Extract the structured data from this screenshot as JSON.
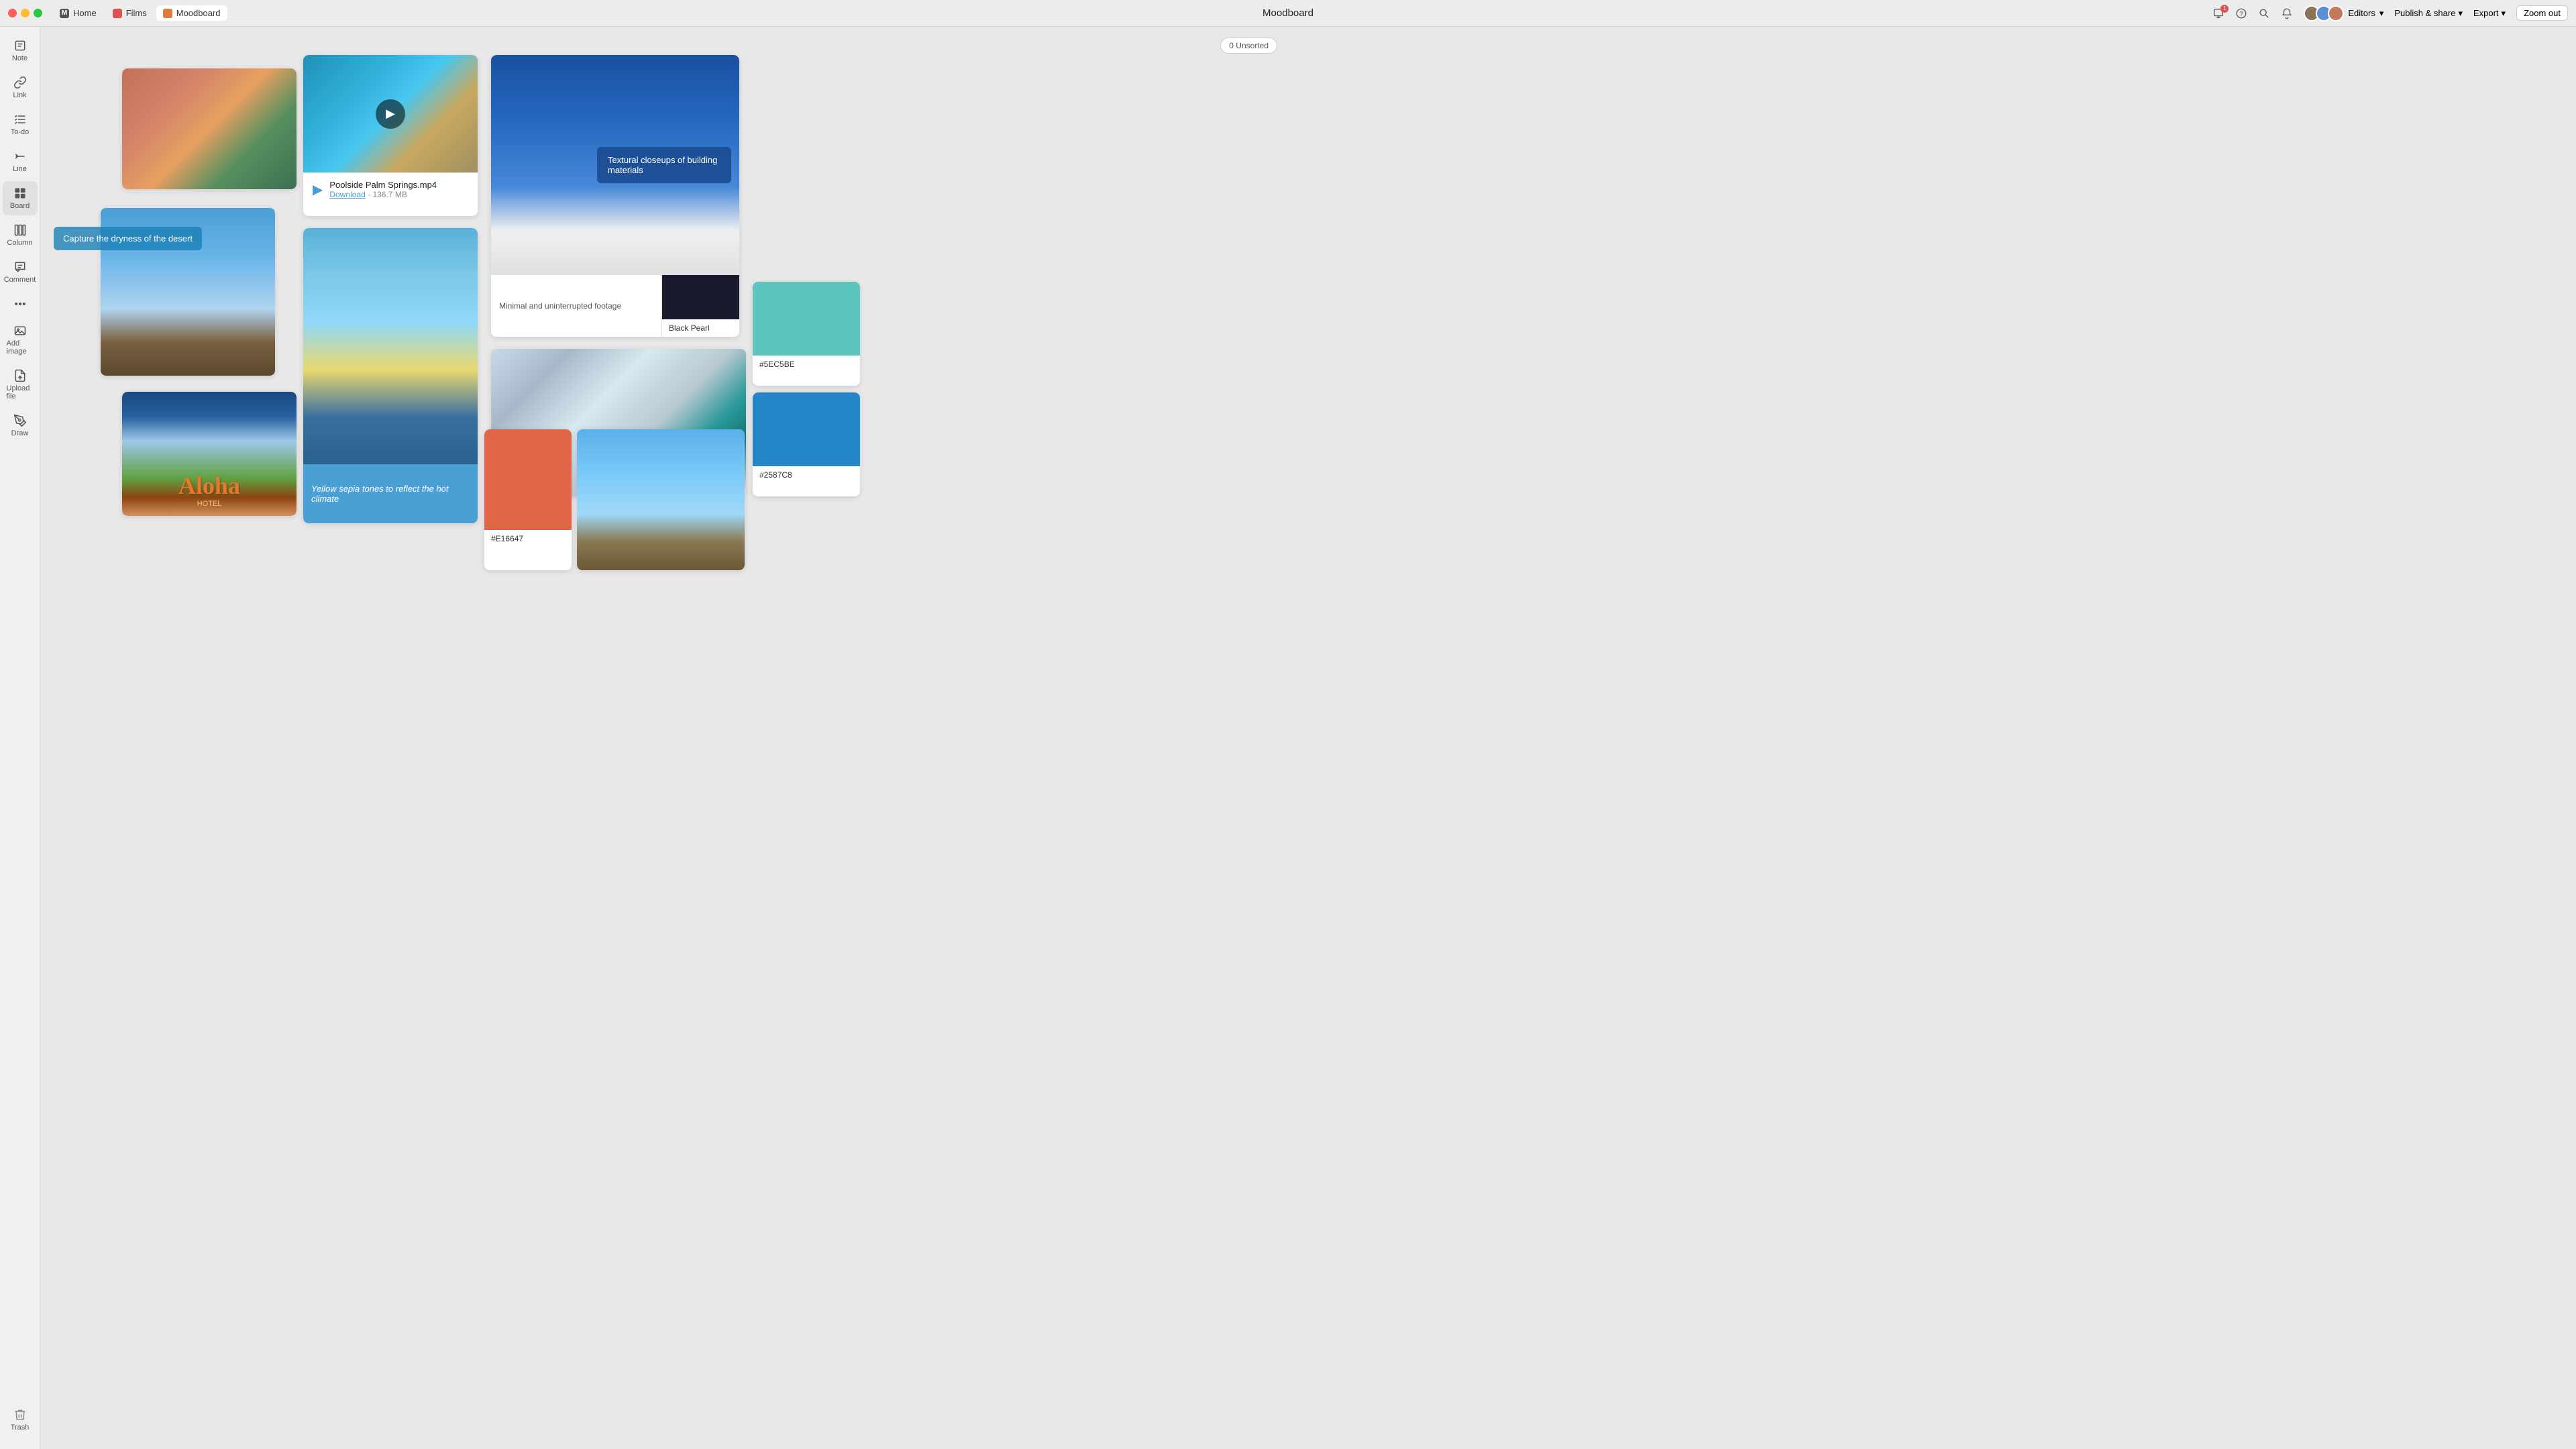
{
  "titlebar": {
    "title": "Moodboard",
    "tabs": [
      {
        "id": "home",
        "label": "Home",
        "icon": "m"
      },
      {
        "id": "films",
        "label": "Films",
        "icon": "red"
      },
      {
        "id": "moodboard",
        "label": "Moodboard",
        "icon": "orange",
        "active": true
      }
    ],
    "editors_label": "Editors",
    "publish_label": "Publish & share",
    "export_label": "Export",
    "zoom_label": "Zoom out",
    "notification_count": "1"
  },
  "sidebar": {
    "items": [
      {
        "id": "note",
        "label": "Note"
      },
      {
        "id": "link",
        "label": "Link"
      },
      {
        "id": "todo",
        "label": "To-do"
      },
      {
        "id": "line",
        "label": "Line"
      },
      {
        "id": "board",
        "label": "Board",
        "active": true
      },
      {
        "id": "column",
        "label": "Column"
      },
      {
        "id": "comment",
        "label": "Comment"
      },
      {
        "id": "more",
        "label": ""
      },
      {
        "id": "add-image",
        "label": "Add image"
      },
      {
        "id": "upload-file",
        "label": "Upload file"
      },
      {
        "id": "draw",
        "label": "Draw"
      },
      {
        "id": "trash",
        "label": "Trash"
      }
    ]
  },
  "canvas": {
    "unsorted_badge": "0 Unsorted",
    "items": {
      "desert_text": "Capture the dryness of the desert",
      "architecture_caption": "Textural closeups of building materials",
      "minimal_caption": "Minimal and uninterrupted footage",
      "black_pearl_label": "Black Pearl",
      "video_filename": "Poolside Palm Springs.mp4",
      "video_download": "Download",
      "video_size": "136.7 MB",
      "yellow_caption": "Yellow sepia tones to reflect the hot climate",
      "color_1_hex": "#5EC5BE",
      "color_2_hex": "#2587C8",
      "color_3_hex": "#E16647"
    }
  }
}
